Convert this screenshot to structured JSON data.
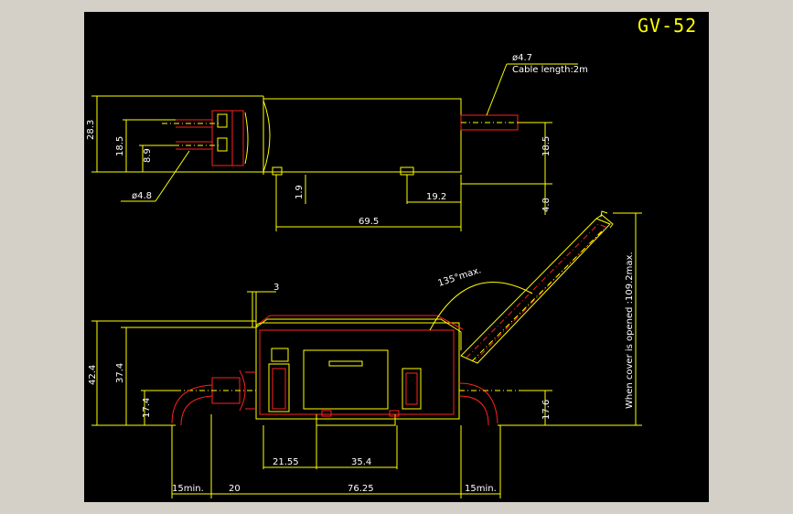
{
  "drawing": {
    "title": "GV-52",
    "labels": {
      "cable_diameter": "ø4.7",
      "cable_length": "Cable length:2m",
      "dim_28_3": "28.3",
      "dim_18_5_left": "18.5",
      "dim_8_9": "8.9",
      "dim_4_8_diameter": "ø4.8",
      "dim_1_9": "1.9",
      "dim_19_2": "19.2",
      "dim_69_5": "69.5",
      "dim_18_5_right": "18.5",
      "dim_4_8": "4.8",
      "dim_3": "3",
      "angle_135": "135°max.",
      "dim_42_4": "42.4",
      "dim_37_4": "37.4",
      "dim_17_4": "17.4",
      "dim_17_6": "17.6",
      "dim_21_55": "21.55",
      "dim_35_4": "35.4",
      "dim_15min_left": "15min.",
      "dim_20": "20",
      "dim_76_25": "76.25",
      "dim_15min_right": "15min.",
      "cover_note": "When cover is opened :109.2max."
    },
    "colors": {
      "background": "#000000",
      "outline": "#ffff00",
      "hidden": "#ff2020",
      "text": "#ffffff"
    }
  }
}
